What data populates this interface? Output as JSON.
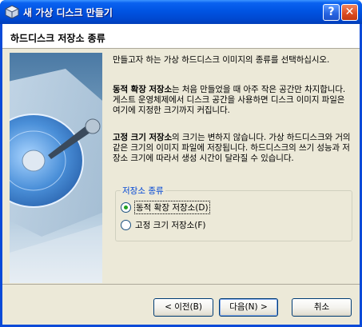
{
  "window": {
    "title": "새 가상 디스크 만들기",
    "help_label": "?",
    "close_label": "✕"
  },
  "header": {
    "title": "하드디스크 저장소 종류"
  },
  "description": {
    "intro": "만들고자 하는 가상 하드디스크 이미지의 종류를 선택하십시오.",
    "dynamic_bold": "동적 확장 저장소",
    "dynamic_text": "는 처음 만들었을 때 아주 작은 공간만 차지합니다. 게스트 운영체제에서 디스크 공간을 사용하면 디스크 이미지 파일은 여기에 지정한 크기까지 커집니다.",
    "fixed_bold": "고정 크기 저장소",
    "fixed_text": "의 크기는 변하지 않습니다. 가상 하드디스크와 거의 같은 크기의 이미지 파일에 저장됩니다. 하드디스크의 쓰기 성능과 저장소 크기에 따라서 생성 시간이 달라질 수 있습니다."
  },
  "storage_group": {
    "label": "저장소 종류",
    "options": [
      {
        "label": "동적 확장 저장소(D)",
        "selected": true
      },
      {
        "label": "고정 크기 저장소(F)",
        "selected": false
      }
    ]
  },
  "buttons": {
    "back": "< 이전(B)",
    "next": "다음(N) >",
    "cancel": "취소"
  },
  "colors": {
    "title_bar": "#0054e3",
    "dialog_bg": "#ece9d8",
    "group_label": "#0046d5",
    "radio_dot": "#21a121"
  },
  "icons": {
    "title": "virtualbox-icon",
    "side": "hard-disk-illustration"
  }
}
